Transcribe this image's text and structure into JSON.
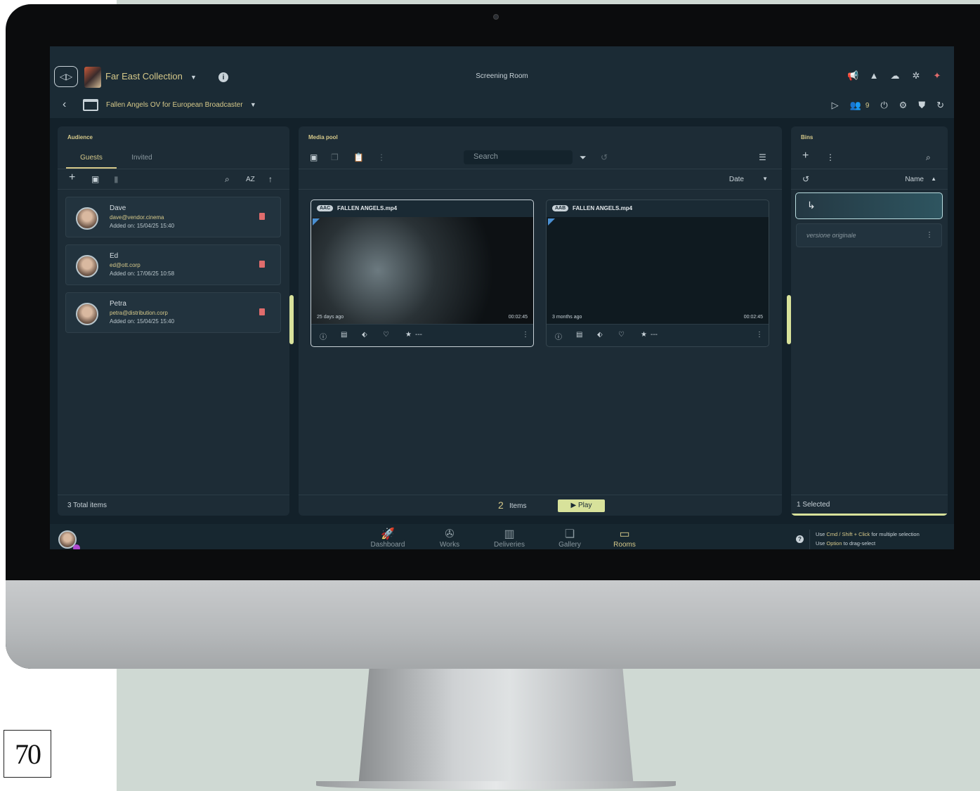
{
  "page_number": "70",
  "header": {
    "collection_title": "Far East Collection",
    "room_title": "Screening Room",
    "project_title": "Fallen Angels OV for European Broadcaster",
    "audience_count": "9"
  },
  "audience": {
    "title": "Audience",
    "tabs": [
      "Guests",
      "Invited"
    ],
    "guests": [
      {
        "name": "Dave",
        "email": "dave@vendor.cinema",
        "added": "Added on: 15/04/25 15:40"
      },
      {
        "name": "Ed",
        "email": "ed@ott.corp",
        "added": "Added on: 17/06/25 10:58"
      },
      {
        "name": "Petra",
        "email": "petra@distribution.corp",
        "added": "Added on: 15/04/25 15:40"
      }
    ],
    "footer": "3 Total items"
  },
  "media_pool": {
    "title": "Media pool",
    "search_placeholder": "Search",
    "sort_label": "Date",
    "cards": [
      {
        "badge": "AAC",
        "title": "FALLEN ANGELS.mp4",
        "age": "25 days ago",
        "duration": "00:02:45",
        "rating": "---"
      },
      {
        "badge": "AAB",
        "title": "FALLEN ANGELS.mp4",
        "age": "3 months ago",
        "duration": "00:02:45",
        "rating": "---"
      }
    ],
    "items_count": "2",
    "items_label": "Items",
    "play_label": "▶  Play"
  },
  "bins": {
    "title": "Bins",
    "sort_label": "Name",
    "active_bin_icon": "↳",
    "items": [
      "versione originale"
    ],
    "footer": "1 Selected"
  },
  "nav": {
    "items": [
      {
        "label": "Dashboard",
        "icon": "rocket-icon"
      },
      {
        "label": "Works",
        "icon": "film-reel-icon"
      },
      {
        "label": "Deliveries",
        "icon": "package-icon"
      },
      {
        "label": "Gallery",
        "icon": "gallery-icon"
      },
      {
        "label": "Rooms",
        "icon": "tv-icon"
      }
    ],
    "active": "Rooms"
  },
  "help": {
    "line1_prefix": "Use ",
    "line1_keys": "Cmd / Shift + Click",
    "line1_suffix": " for multiple selection",
    "line2_prefix": "Use ",
    "line2_keys": "Option",
    "line2_suffix": " to drag-select"
  },
  "colors": {
    "accent": "#d6c98a",
    "play": "#d8e29b",
    "danger": "#e06c6c",
    "panel": "#1d2c36"
  }
}
